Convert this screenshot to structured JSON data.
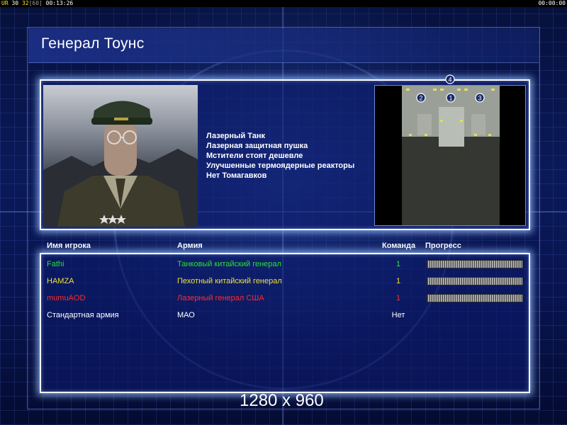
{
  "hud": {
    "label_ur": "UR",
    "v1": "30",
    "v2": "32",
    "v3": "[60]",
    "time_left": "00:13:26",
    "time_right": "00:00:00"
  },
  "general": {
    "title": "Генерал Тоунс",
    "features": [
      "Лазерный Танк",
      "Лазерная защитная пушка",
      "Мстители стоят дешевле",
      "Улучшенные термоядерные реакторы",
      "Нет Томагавков"
    ]
  },
  "minimap": {
    "slots": [
      "4",
      "2",
      "1",
      "3"
    ]
  },
  "table": {
    "headers": {
      "player": "Имя игрока",
      "army": "Армия",
      "team": "Команда",
      "progress": "Прогресс"
    },
    "rows": [
      {
        "player": "Fathi",
        "army": "Танковый китайский генерал",
        "team": "1",
        "progress": 1.0,
        "color": "#2ee02e"
      },
      {
        "player": "HAMZA",
        "army": "Пехотный китайский генерал",
        "team": "1",
        "progress": 1.0,
        "color": "#f0e030"
      },
      {
        "player": "mumuAOD",
        "army": "Лазерный генерал США",
        "team": "1",
        "progress": 1.0,
        "color": "#ff2a2a"
      },
      {
        "player": "Стандартная армия",
        "army": "МАО",
        "team": "Нет",
        "color": "#ffffff"
      }
    ]
  },
  "resolution": "1280 x 960",
  "colors": {
    "accent": "#7fa8ff",
    "panel_border": "#ffffff"
  }
}
